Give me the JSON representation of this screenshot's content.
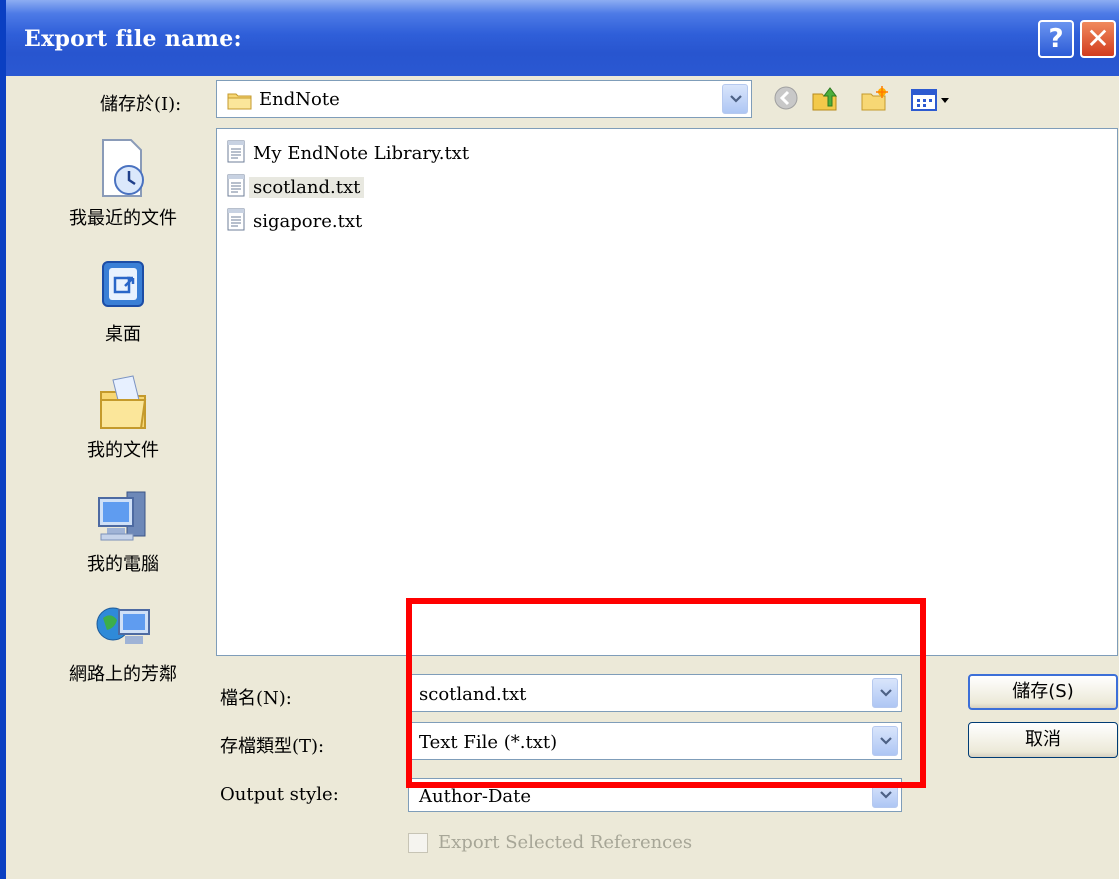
{
  "window": {
    "title": "Export file name:",
    "help_label": "?",
    "close_label": "✕"
  },
  "save_in": {
    "label": "儲存於(I):",
    "folder": "EndNote"
  },
  "toolbar": {
    "icons": [
      "back-icon",
      "up-folder-icon",
      "new-folder-icon",
      "view-menu-icon"
    ]
  },
  "places": [
    {
      "label": "我最近的文件",
      "icon": "recent-documents-icon"
    },
    {
      "label": "桌面",
      "icon": "desktop-icon"
    },
    {
      "label": "我的文件",
      "icon": "my-documents-icon"
    },
    {
      "label": "我的電腦",
      "icon": "my-computer-icon"
    },
    {
      "label": "網路上的芳鄰",
      "icon": "network-places-icon"
    }
  ],
  "files": [
    {
      "name": "My EndNote Library.txt",
      "selected": false
    },
    {
      "name": "scotland.txt",
      "selected": true
    },
    {
      "name": "sigapore.txt",
      "selected": false
    }
  ],
  "filename": {
    "label": "檔名(N):",
    "value": "scotland.txt"
  },
  "filetype": {
    "label": "存檔類型(T):",
    "value": "Text File (*.txt)"
  },
  "output_style": {
    "label": "Output style:",
    "value": "Author-Date"
  },
  "export_selected": {
    "label": "Export Selected References",
    "checked": false,
    "enabled": false
  },
  "buttons": {
    "save": "儲存(S)",
    "cancel": "取消"
  },
  "colors": {
    "titlebar": "#2855cf",
    "dialog_bg": "#ece9d8",
    "highlight": "#ff0000"
  }
}
